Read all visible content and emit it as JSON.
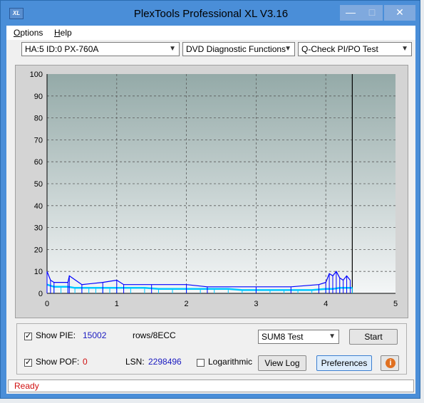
{
  "window": {
    "title": "PlexTools Professional XL V3.16",
    "app_icon": "XL"
  },
  "menu": [
    {
      "label": "Options",
      "accel": "O"
    },
    {
      "label": "Help",
      "accel": "H"
    }
  ],
  "toolbar": {
    "drive": "HA:5 ID:0  PX-760A",
    "function": "DVD Diagnostic Functions",
    "test": "Q-Check PI/PO Test"
  },
  "chart_data": {
    "type": "line",
    "title": "",
    "xlabel": "",
    "ylabel": "",
    "xlim": [
      0,
      5
    ],
    "ylim": [
      0,
      100
    ],
    "x_ticks": [
      "0",
      "1",
      "2",
      "3",
      "4",
      "5"
    ],
    "y_ticks": [
      "0",
      "10",
      "20",
      "30",
      "40",
      "50",
      "60",
      "70",
      "80",
      "90",
      "100"
    ],
    "grid": true,
    "end_marker_x": 4.38,
    "series": [
      {
        "x": [
          0.0,
          0.1,
          0.2,
          0.3,
          0.4,
          0.5,
          0.6,
          0.7,
          0.8,
          0.9,
          1.0,
          1.2,
          1.4,
          1.6,
          1.8,
          2.0,
          2.2,
          2.4,
          2.6,
          2.8,
          3.0,
          3.2,
          3.4,
          3.6,
          3.8,
          4.0,
          4.1,
          4.2,
          4.3,
          4.38
        ],
        "y": [
          4,
          3,
          3,
          3,
          2.5,
          2.5,
          2.5,
          2.5,
          2.5,
          2.5,
          2.5,
          2.5,
          2.5,
          2,
          2,
          2,
          2,
          2,
          2,
          1.5,
          1.5,
          1.5,
          1.5,
          1.5,
          1.5,
          2,
          2,
          2.5,
          2.5,
          2.5
        ],
        "color": "#00c8ff"
      },
      {
        "x": [
          0.0,
          0.05,
          0.1,
          0.3,
          0.32,
          0.5,
          0.8,
          1.0,
          1.1,
          1.5,
          2.0,
          2.3,
          3.0,
          3.5,
          3.9,
          4.0,
          4.05,
          4.1,
          4.15,
          4.2,
          4.25,
          4.3,
          4.35
        ],
        "y": [
          10,
          6,
          5,
          5,
          8,
          4,
          5,
          6,
          4,
          4,
          4,
          3,
          3,
          3,
          4,
          5,
          9,
          8,
          10,
          7,
          6,
          8,
          6
        ],
        "color": "#0000ff"
      }
    ]
  },
  "controls": {
    "show_pie_label": "Show PIE:",
    "pie_value": "15002",
    "pie_unit": "rows/8ECC",
    "show_poe_label": "Show POF:",
    "poe_value": "0",
    "lsn_label": "LSN:",
    "lsn_value": "2298496",
    "logarithmic_label": "Logarithmic",
    "sum_select": "SUM8 Test",
    "start_button": "Start",
    "view_log_button": "View Log",
    "preferences_button": "Preferences"
  },
  "status": {
    "text": "Ready"
  }
}
